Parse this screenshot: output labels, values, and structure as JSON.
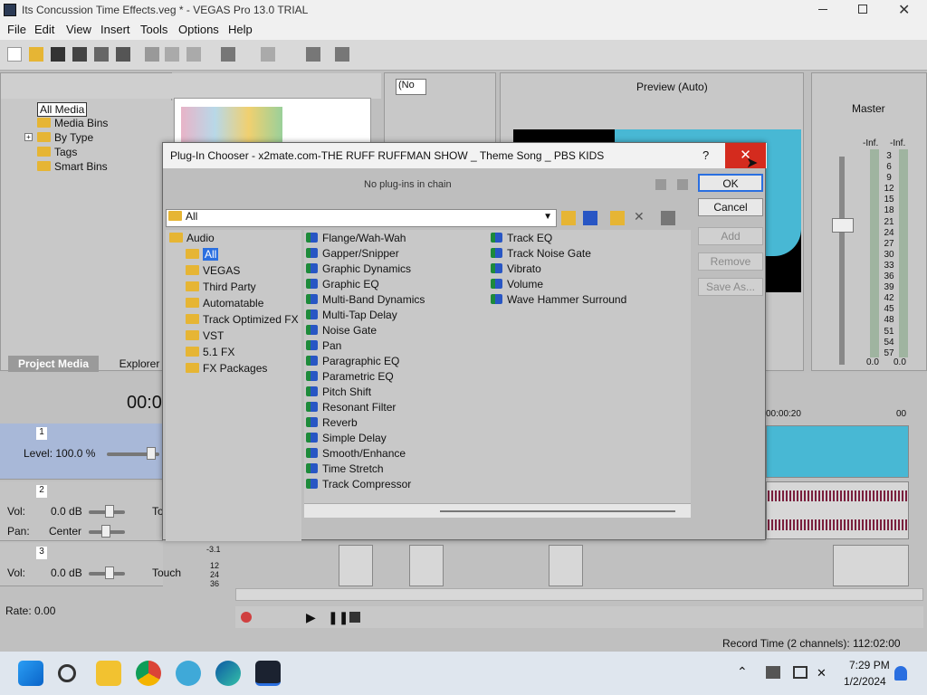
{
  "window": {
    "title": "Its Concussion Time Effects.veg * - VEGAS Pro 13.0 TRIAL"
  },
  "menu": [
    "File",
    "Edit",
    "View",
    "Insert",
    "Tools",
    "Options",
    "Help"
  ],
  "project_media": {
    "tree": [
      "All Media",
      "Media Bins",
      "By Type",
      "Tags",
      "Smart Bins"
    ],
    "tabs": [
      "Project Media",
      "Explorer"
    ]
  },
  "preview": {
    "label": "Preview (Auto)",
    "fx_dropdown": "(No"
  },
  "master": {
    "label": "Master",
    "inf_left": "-Inf.",
    "inf_right": "-Inf.",
    "scale": [
      "3",
      "6",
      "9",
      "12",
      "15",
      "18",
      "21",
      "24",
      "27",
      "30",
      "33",
      "36",
      "39",
      "42",
      "45",
      "48",
      "51",
      "54",
      "57"
    ],
    "bottom_left": "0.0",
    "bottom_right": "0.0"
  },
  "timeline": {
    "timecode": "00:0",
    "ruler_mark": "00:00:20",
    "ruler_mark2": "00",
    "rate": "Rate: 0.00",
    "record_time": "Record Time (2 channels): 112:02:00",
    "meter_top": "-3.1",
    "meter_nums": [
      "12",
      "24",
      "36"
    ]
  },
  "tracks": [
    {
      "num": "1",
      "level_label": "Level: 100.0 %"
    },
    {
      "num": "2",
      "vol_label": "Vol:",
      "vol_value": "0.0 dB",
      "pan_label": "Pan:",
      "pan_value": "Center",
      "touch": "To"
    },
    {
      "num": "3",
      "vol_label": "Vol:",
      "vol_value": "0.0 dB",
      "touch": "Touch"
    }
  ],
  "dialog": {
    "title": "Plug-In Chooser - x2mate.com-THE RUFF RUFFMAN SHOW _ Theme Song _ PBS KIDS",
    "help": "?",
    "chain_status": "No plug-ins in chain",
    "filter": "All",
    "buttons": {
      "ok": "OK",
      "cancel": "Cancel",
      "add": "Add",
      "remove": "Remove",
      "save_as": "Save As..."
    },
    "folders": {
      "root": "Audio",
      "items": [
        "All",
        "VEGAS",
        "Third Party",
        "Automatable",
        "Track Optimized FX",
        "VST",
        "5.1 FX",
        "FX Packages"
      ],
      "selected": "All"
    },
    "plugins_col1": [
      "Flange/Wah-Wah",
      "Gapper/Snipper",
      "Graphic Dynamics",
      "Graphic EQ",
      "Multi-Band Dynamics",
      "Multi-Tap Delay",
      "Noise Gate",
      "Pan",
      "Paragraphic EQ",
      "Parametric EQ",
      "Pitch Shift",
      "Resonant Filter",
      "Reverb",
      "Simple Delay",
      "Smooth/Enhance",
      "Time Stretch",
      "Track Compressor"
    ],
    "plugins_col2": [
      "Track EQ",
      "Track Noise Gate",
      "Vibrato",
      "Volume",
      "Wave Hammer Surround"
    ]
  },
  "taskbar": {
    "time": "7:29 PM",
    "date": "1/2/2024"
  }
}
